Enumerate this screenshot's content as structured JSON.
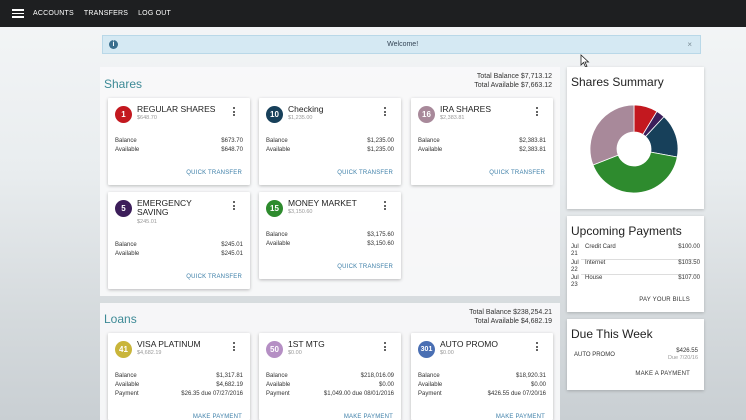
{
  "nav": {
    "items": [
      {
        "label": "ACCOUNTS"
      },
      {
        "label": "TRANSFERS"
      },
      {
        "label": "LOG OUT"
      }
    ]
  },
  "alert": {
    "message": "Welcome!",
    "close": "×",
    "icon": "i"
  },
  "shares": {
    "title": "Shares",
    "total_balance": "Total Balance  $7,713.12",
    "total_available": "Total Available  $7,663.12",
    "cards": [
      {
        "number": "1",
        "name": "REGULAR SHARES",
        "sub": "$648.70",
        "color": "#c3181f",
        "rows": [
          {
            "label": "Balance",
            "value": "$673.70"
          },
          {
            "label": "Available",
            "value": "$648.70"
          }
        ],
        "action": "QUICK TRANSFER"
      },
      {
        "number": "10",
        "name": "Checking",
        "sub": "$1,235.00",
        "color": "#17405a",
        "rows": [
          {
            "label": "Balance",
            "value": "$1,235.00"
          },
          {
            "label": "Available",
            "value": "$1,235.00"
          }
        ],
        "action": "QUICK TRANSFER"
      },
      {
        "number": "16",
        "name": "IRA SHARES",
        "sub": "$2,383.81",
        "color": "#a8899a",
        "rows": [
          {
            "label": "Balance",
            "value": "$2,383.81"
          },
          {
            "label": "Available",
            "value": "$2,383.81"
          }
        ],
        "action": "QUICK TRANSFER"
      },
      {
        "number": "5",
        "name": "EMERGENCY SAVING",
        "sub": "$245.01",
        "color": "#3c1e5a",
        "rows": [
          {
            "label": "Balance",
            "value": "$245.01"
          },
          {
            "label": "Available",
            "value": "$245.01"
          }
        ],
        "action": "QUICK TRANSFER"
      },
      {
        "number": "15",
        "name": "MONEY MARKET",
        "sub": "$3,150.60",
        "color": "#2e8b2e",
        "rows": [
          {
            "label": "Balance",
            "value": "$3,175.60"
          },
          {
            "label": "Available",
            "value": "$3,150.60"
          }
        ],
        "action": "QUICK TRANSFER"
      }
    ]
  },
  "loans": {
    "title": "Loans",
    "total_balance": "Total Balance $238,254.21",
    "total_available": "Total Available  $4,682.19",
    "cards": [
      {
        "number": "41",
        "name": "VISA PLATINUM",
        "sub": "$4,682.19",
        "color": "#c9b53a",
        "rows": [
          {
            "label": "Balance",
            "value": "$1,317.81"
          },
          {
            "label": "Available",
            "value": "$4,682.19"
          },
          {
            "label": "Payment",
            "value": "$26.35 due 07/27/2016"
          }
        ],
        "action": "MAKE PAYMENT"
      },
      {
        "number": "50",
        "name": "1ST MTG",
        "sub": "$0.00",
        "color": "#b58fc4",
        "rows": [
          {
            "label": "Balance",
            "value": "$218,016.09"
          },
          {
            "label": "Available",
            "value": "$0.00"
          },
          {
            "label": "Payment",
            "value": "$1,049.00 due 08/01/2016"
          }
        ],
        "action": "MAKE PAYMENT"
      },
      {
        "number": "301",
        "name": "AUTO PROMO",
        "sub": "$0.00",
        "color": "#4a6fb3",
        "rows": [
          {
            "label": "Balance",
            "value": "$18,920.31"
          },
          {
            "label": "Available",
            "value": "$0.00"
          },
          {
            "label": "Payment",
            "value": "$426.55 due 07/20/16"
          }
        ],
        "action": "MAKE PAYMENT"
      }
    ]
  },
  "summary": {
    "title": "Shares Summary",
    "chart_data": {
      "type": "pie",
      "values": [
        673.7,
        245.01,
        1235.0,
        3175.6,
        2383.81
      ],
      "colors": [
        "#c3181f",
        "#3c1e5a",
        "#17405a",
        "#2e8b2e",
        "#a8899a"
      ]
    }
  },
  "upcoming": {
    "title": "Upcoming Payments",
    "items": [
      {
        "date": "Jul 21",
        "name": "Credit Card",
        "amount": "$100.00"
      },
      {
        "date": "Jul 22",
        "name": "Internet",
        "amount": "$103.50"
      },
      {
        "date": "Jul 23",
        "name": "House",
        "amount": "$107.00"
      }
    ],
    "action": "PAY YOUR BILLS"
  },
  "due": {
    "title": "Due This Week",
    "item": {
      "name": "AUTO PROMO",
      "amount": "$426.55",
      "date": "Due 7/20/16"
    },
    "action": "MAKE A PAYMENT"
  }
}
